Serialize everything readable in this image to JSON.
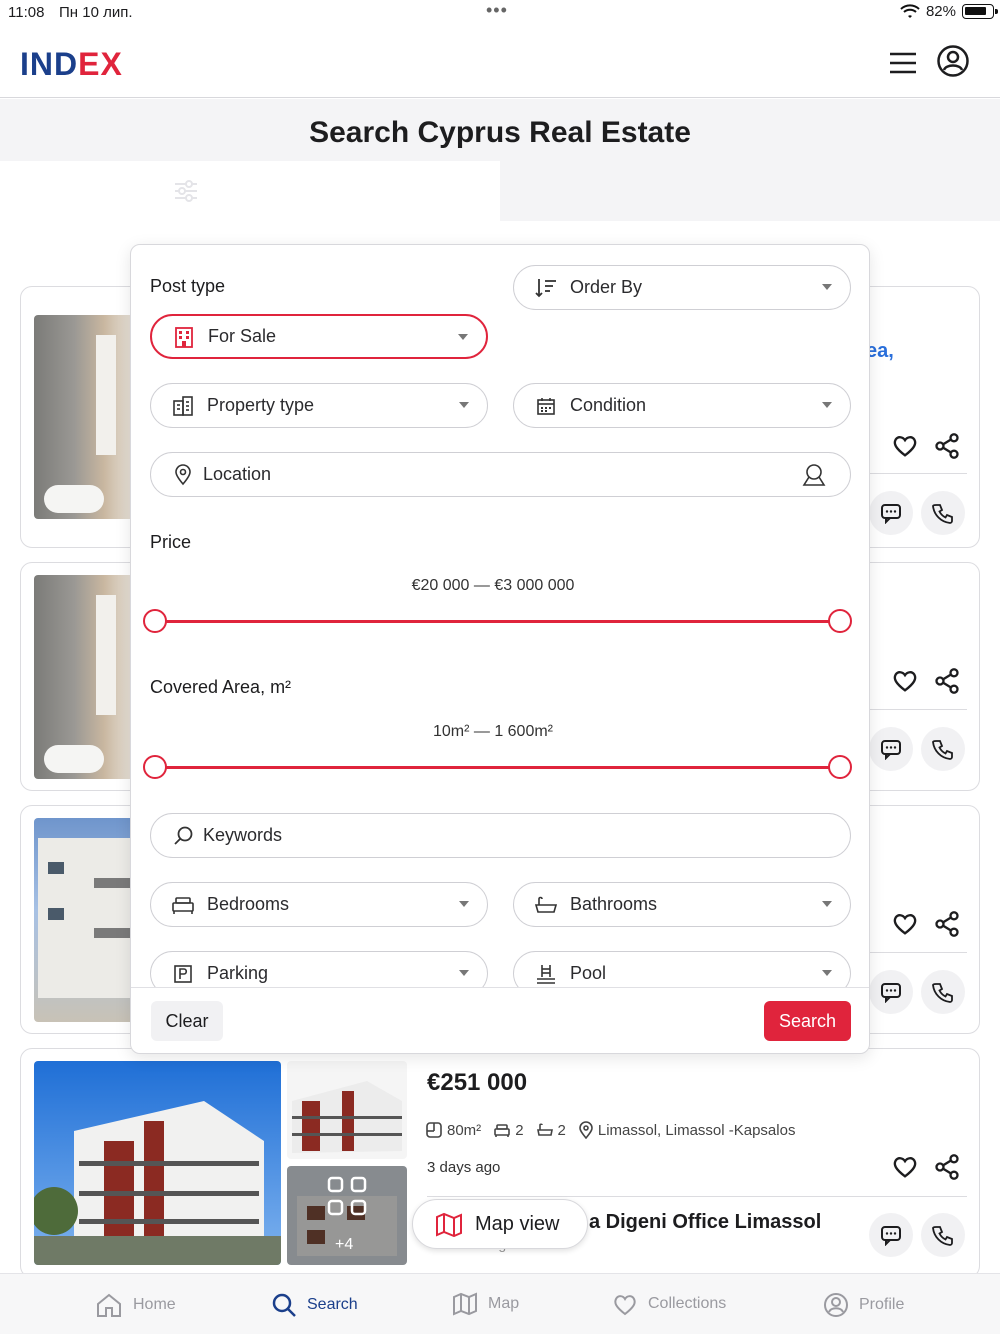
{
  "status_bar": {
    "time": "11:08",
    "date": "Пн 10 лип.",
    "battery": "82%",
    "battery_level": 0.82
  },
  "header": {
    "logo_part1": "IND",
    "logo_part2": "EX"
  },
  "page": {
    "title": "Search Cyprus Real Estate"
  },
  "cards": {
    "fragment_text": "ea,"
  },
  "filters": {
    "post_type_label": "Post type",
    "post_type_value": "For Sale",
    "order_by": "Order By",
    "property_type": "Property type",
    "condition": "Condition",
    "location_placeholder": "Location",
    "price_label": "Price",
    "price_range": "€20 000 — €3 000 000",
    "area_label": "Covered Area, m²",
    "area_range": "10m² — 1 600m²",
    "keywords_placeholder": "Keywords",
    "bedrooms": "Bedrooms",
    "bathrooms": "Bathrooms",
    "parking": "Parking",
    "pool": "Pool",
    "clear_label": "Clear",
    "search_label": "Search"
  },
  "listing": {
    "price": "€251 000",
    "area": "80m²",
    "bedrooms": "2",
    "bathrooms": "2",
    "location": "Limassol, Limassol -Kapsalos",
    "posted": "3 days ago",
    "agent_name": "a Digeni Office Limassol",
    "agent_role": "Agent",
    "photo_more": "+4"
  },
  "map_view_label": "Map view",
  "tabbar": {
    "items": [
      {
        "label": "Home",
        "icon": "home-icon"
      },
      {
        "label": "Search",
        "icon": "search-icon"
      },
      {
        "label": "Map",
        "icon": "map-icon"
      },
      {
        "label": "Collections",
        "icon": "heart-icon"
      },
      {
        "label": "Profile",
        "icon": "profile-icon"
      }
    ],
    "active": "Search"
  },
  "colors": {
    "brand_blue": "#1b3f8b",
    "brand_red": "#e0243c"
  }
}
